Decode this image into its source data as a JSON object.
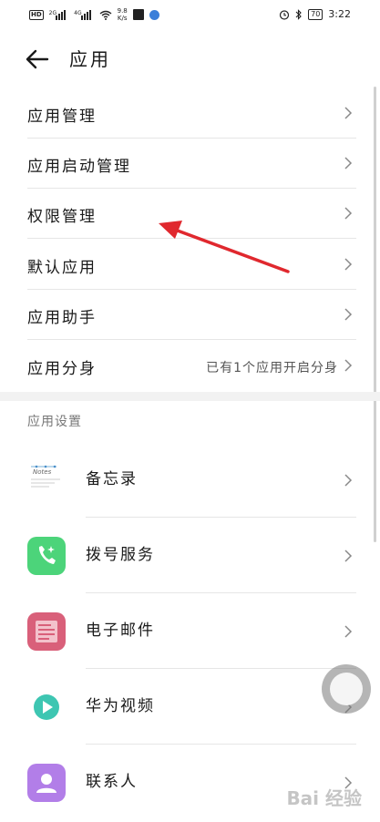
{
  "status_bar": {
    "hd": "HD",
    "sig1": "2G",
    "sig2": "4G",
    "speed_value": "9.8",
    "speed_unit": "K/s",
    "battery": "70",
    "time": "3:22"
  },
  "header": {
    "title": "应用"
  },
  "settings_items": [
    {
      "label": "应用管理"
    },
    {
      "label": "应用启动管理"
    },
    {
      "label": "权限管理"
    },
    {
      "label": "默认应用"
    },
    {
      "label": "应用助手"
    },
    {
      "label": "应用分身",
      "value": "已有1个应用开启分身"
    }
  ],
  "section": {
    "title": "应用设置"
  },
  "apps": [
    {
      "name": "备忘录",
      "icon": "notes-icon",
      "color": "#ffffff"
    },
    {
      "name": "拨号服务",
      "icon": "phone-icon",
      "color": "#4cd47a"
    },
    {
      "name": "电子邮件",
      "icon": "mail-icon",
      "color": "#d9607a"
    },
    {
      "name": "华为视频",
      "icon": "video-play-icon",
      "color": "#3ec6b2"
    },
    {
      "name": "联系人",
      "icon": "contact-icon",
      "color": "#b27ee8"
    }
  ],
  "notes_icon_text": "Notes",
  "annotation": {
    "color": "#e0282e"
  },
  "watermark": "Bai 经验"
}
